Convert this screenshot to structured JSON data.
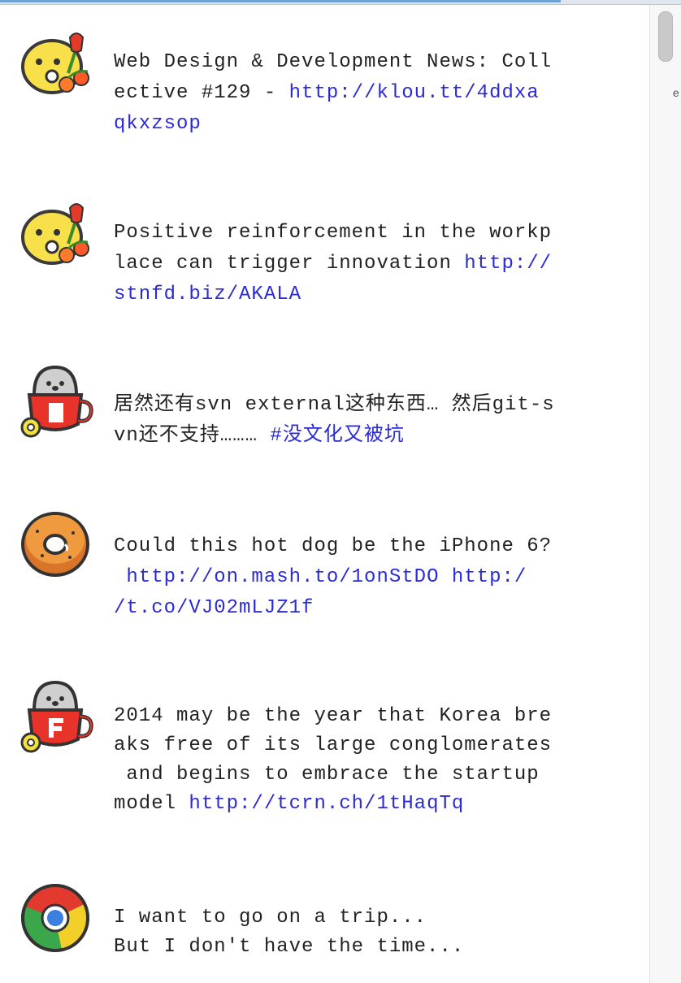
{
  "window": {
    "edge_glyph": "e"
  },
  "posts": [
    {
      "avatar": "tulip-chick-icon",
      "text": "Web Design & Development News: Coll\nective #129 - ",
      "link": "http://klou.tt/4ddxa\nqkxzsop"
    },
    {
      "avatar": "tulip-chick-icon",
      "text": "Positive reinforcement in the workp\nlace can trigger innovation ",
      "link": "http://\nstnfd.biz/AKALA"
    },
    {
      "avatar": "seal-in-cup-icon",
      "text": "居然还有svn external这种东西… 然后git-s\nvn还不支持……… ",
      "link": "#没文化又被坑"
    },
    {
      "avatar": "donut-icon",
      "text": "Could this hot dog be the iPhone 6?\n ",
      "link": "http://on.mash.to/1onStDO http:/\n/t.co/VJ02mLJZ1f"
    },
    {
      "avatar": "seal-in-cup-icon",
      "text": "2014 may be the year that Korea bre\naks free of its large conglomerates\n and begins to embrace the startup\nmodel ",
      "link": "http://tcrn.ch/1tHaqTq"
    },
    {
      "avatar": "chrome-icon",
      "text": "I want to go on a trip...\nBut I don't have the time...",
      "link": ""
    }
  ],
  "colors": {
    "link": "#2b2bd6",
    "text": "#222222"
  }
}
